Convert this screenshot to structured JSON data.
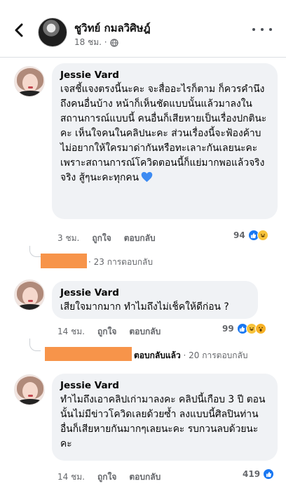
{
  "header": {
    "page_name": "ชูวิทย์ กมลวิศิษฎ์",
    "time": "18 ชม. ·"
  },
  "comments": [
    {
      "author": "Jessie Vard",
      "text": "เจสชี้แจงตรงนี้นะคะ จะสื่ออะไรก็ตาม ก็ควรคำนึงถึงคนอื่นบ้าง หน้าก็เห็นชัดแบบนั้นแล้วมาลงในสถานการณ์แบบนี้ คนอื่นก็เสียหายเป็นเรื่องปกตินะคะ เห็นใจคนในคลิปนะคะ ส่วนเรื่องนี้จะฟ้องค้าบ ไม่อยากให้ใครมาด่ากันหรือทะเลาะกันเลยนะคะ เพราะสถานการณ์โควิดตอนนี้ก็แย่มากพอแล้วจริงจริง สู้ๆนะคะทุกคน",
      "time": "3 ชม.",
      "like": "ถูกใจ",
      "reply": "ตอบกลับ",
      "reaction_count": "94",
      "replies_text": "· 23 การตอบกลับ"
    },
    {
      "author": "Jessie Vard",
      "text": "เสียใจมากมาก ทำไมถึงไม่เช็คให้ดีก่อน ?",
      "time": "14 ชม.",
      "like": "ถูกใจ",
      "reply": "ตอบกลับ",
      "reaction_count": "99",
      "replied_label": "ตอบกลับแล้ว",
      "replies_text": "· 20 การตอบกลับ"
    },
    {
      "author": "Jessie Vard",
      "text": "ทำไมถึงเอาคลิปเก่ามาลงคะ คลิปนี้เกือบ 3 ปี ตอนนั้นไม่มีข่าวโควิดเลยด้วยซ้ำ ลงแบบนี้ศิลปินท่านอื่นก็เสียหายกันมากๆเลยนะคะ รบกวนลบด้วยนะคะ",
      "time": "14 ชม.",
      "like": "ถูกใจ",
      "reply": "ตอบกลับ",
      "reaction_count": "419"
    }
  ]
}
